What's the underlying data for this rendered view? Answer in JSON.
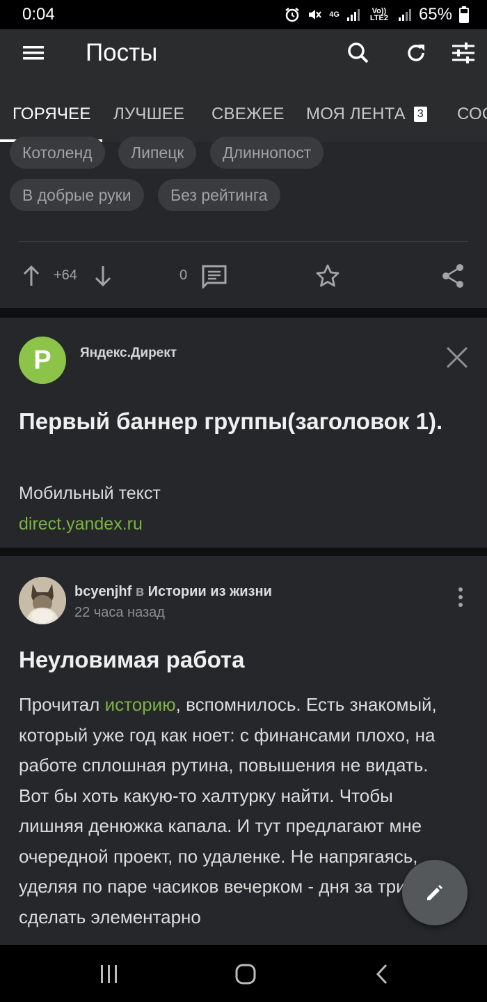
{
  "status_bar": {
    "time": "0:04",
    "network_label_1": "4G",
    "network_label_2": "Vo)) LTE2",
    "battery": "65%"
  },
  "app_bar": {
    "title": "Посты",
    "icons": [
      "menu-icon",
      "search-icon",
      "refresh-icon",
      "filter-icon"
    ]
  },
  "tabs": [
    {
      "label": "ГОРЯЧЕЕ",
      "active": true
    },
    {
      "label": "ЛУЧШЕЕ"
    },
    {
      "label": "СВЕЖЕЕ"
    },
    {
      "label": "МОЯ ЛЕНТА",
      "badge": "3"
    },
    {
      "label": "СОО"
    }
  ],
  "prev_post": {
    "tags": [
      "Котоленд",
      "Липецк",
      "Длиннопост",
      "В добрые руки",
      "Без рейтинга"
    ],
    "rating": "+64",
    "comments": "0"
  },
  "ad": {
    "logo_letter": "P",
    "source": "Яндекс.Директ",
    "title": "Первый баннер группы(заголовок 1).",
    "text": "Мобильный текст",
    "link": "direct.yandex.ru"
  },
  "post": {
    "author": "bcyenjhf",
    "in": "в",
    "community": "Истории из жизни",
    "time": "22 часа назад",
    "title": "Неуловимая работа",
    "body_before_link": "Прочитал ",
    "body_link": "историю",
    "body_after_link": ", вспомнилось. Есть знакомый, который уже год как ноет: с финансами плохо, на работе сплошная рутина, повышения не видать. Вот бы хоть какую-то халтурку найти. Чтобы лишняя денюжка капала. И тут предлагают мне очередной проект, по удаленке. Не напрягаясь, уделяя по паре часиков вечерком - дня за три сделать элементарно"
  },
  "colors": {
    "accent_green": "#7cb342",
    "logo_green": "#8cc44a",
    "card_bg": "#25272a",
    "appbar_bg": "#2a2c2e"
  }
}
